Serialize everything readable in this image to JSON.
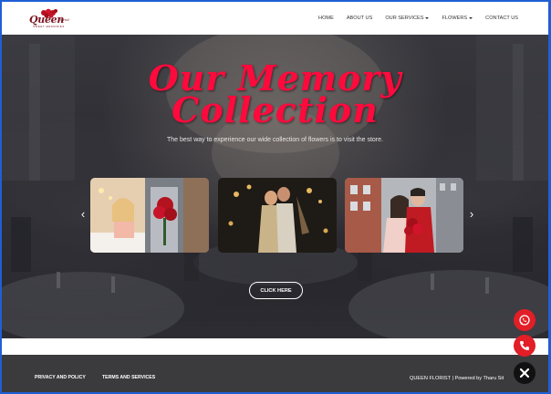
{
  "brand": {
    "logo_text": "Queen",
    "logo_script": "florist",
    "logo_sub": "SWEET MEMORIES"
  },
  "nav": {
    "items": [
      {
        "label": "HOME",
        "dropdown": false
      },
      {
        "label": "ABOUT US",
        "dropdown": false
      },
      {
        "label": "OUR SERVICES",
        "dropdown": true
      },
      {
        "label": "FLOWERS",
        "dropdown": true
      },
      {
        "label": "CONTACT US",
        "dropdown": false
      }
    ]
  },
  "hero": {
    "title_line1": "Our Memory",
    "title_line2": "Collection",
    "subtitle": "The best way to experience our wide collection of flowers is to visit the store.",
    "cta_label": "CLICK HERE",
    "prev_arrow": "‹",
    "next_arrow": "›"
  },
  "footer": {
    "privacy": "PRIVACY AND POLICY",
    "terms": "TERMS AND SERVICES",
    "copyright": "QUEEN FLORIST | Powered by Tharu Sit"
  },
  "float_buttons": {
    "whatsapp_icon": "whatsapp-icon",
    "phone_icon": "phone-icon",
    "close_icon": "close-icon"
  },
  "colors": {
    "accent": "#ff0a3c",
    "float_red": "#e21e26",
    "footer_bg": "#3b3b3e",
    "frame_border": "#1f5fd6"
  }
}
